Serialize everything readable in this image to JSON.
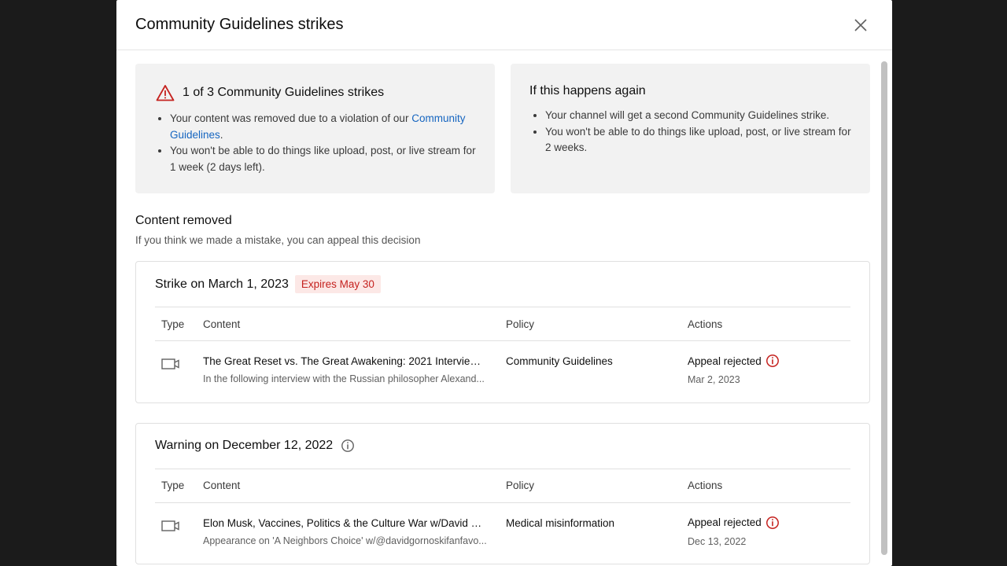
{
  "dialog": {
    "title": "Community Guidelines strikes"
  },
  "strike_summary": {
    "title": "1 of 3 Community Guidelines strikes",
    "bullet1_prefix": "Your content was removed due to a violation of our ",
    "bullet1_link": "Community Guidelines",
    "bullet1_suffix": ".",
    "bullet2": "You won't be able to do things like upload, post, or live stream for 1 week (2 days left)."
  },
  "if_again": {
    "title": "If this happens again",
    "bullet1": "Your channel will get a second Community Guidelines strike.",
    "bullet2": "You won't be able to do things like upload, post, or live stream for 2 weeks."
  },
  "content_removed": {
    "title": "Content removed",
    "subtitle": "If you think we made a mistake, you can appeal this decision"
  },
  "columns": {
    "type": "Type",
    "content": "Content",
    "policy": "Policy",
    "actions": "Actions"
  },
  "strikes": [
    {
      "heading": "Strike on March 1, 2023",
      "badge": "Expires May 30",
      "title": "The Great Reset vs. The Great Awakening: 2021 Interview w...",
      "description": "In the following interview with the Russian philosopher Alexand...",
      "policy": "Community Guidelines",
      "action": "Appeal rejected",
      "action_date": "Mar 2, 2023"
    },
    {
      "heading": "Warning on December 12, 2022",
      "title": "Elon Musk, Vaccines, Politics & the Culture War w/David Go...",
      "description": "Appearance on 'A Neighbors Choice' w/@davidgornoskifanfavo...",
      "policy": "Medical misinformation",
      "action": "Appeal rejected",
      "action_date": "Dec 13, 2022"
    }
  ],
  "colors": {
    "badge_bg": "#fce8e6",
    "badge_text": "#c5221f",
    "link": "#1565c0",
    "card_bg": "#f2f2f2"
  },
  "icons": [
    "close-icon",
    "warning-icon",
    "video-icon",
    "info-icon",
    "error-info-icon"
  ]
}
